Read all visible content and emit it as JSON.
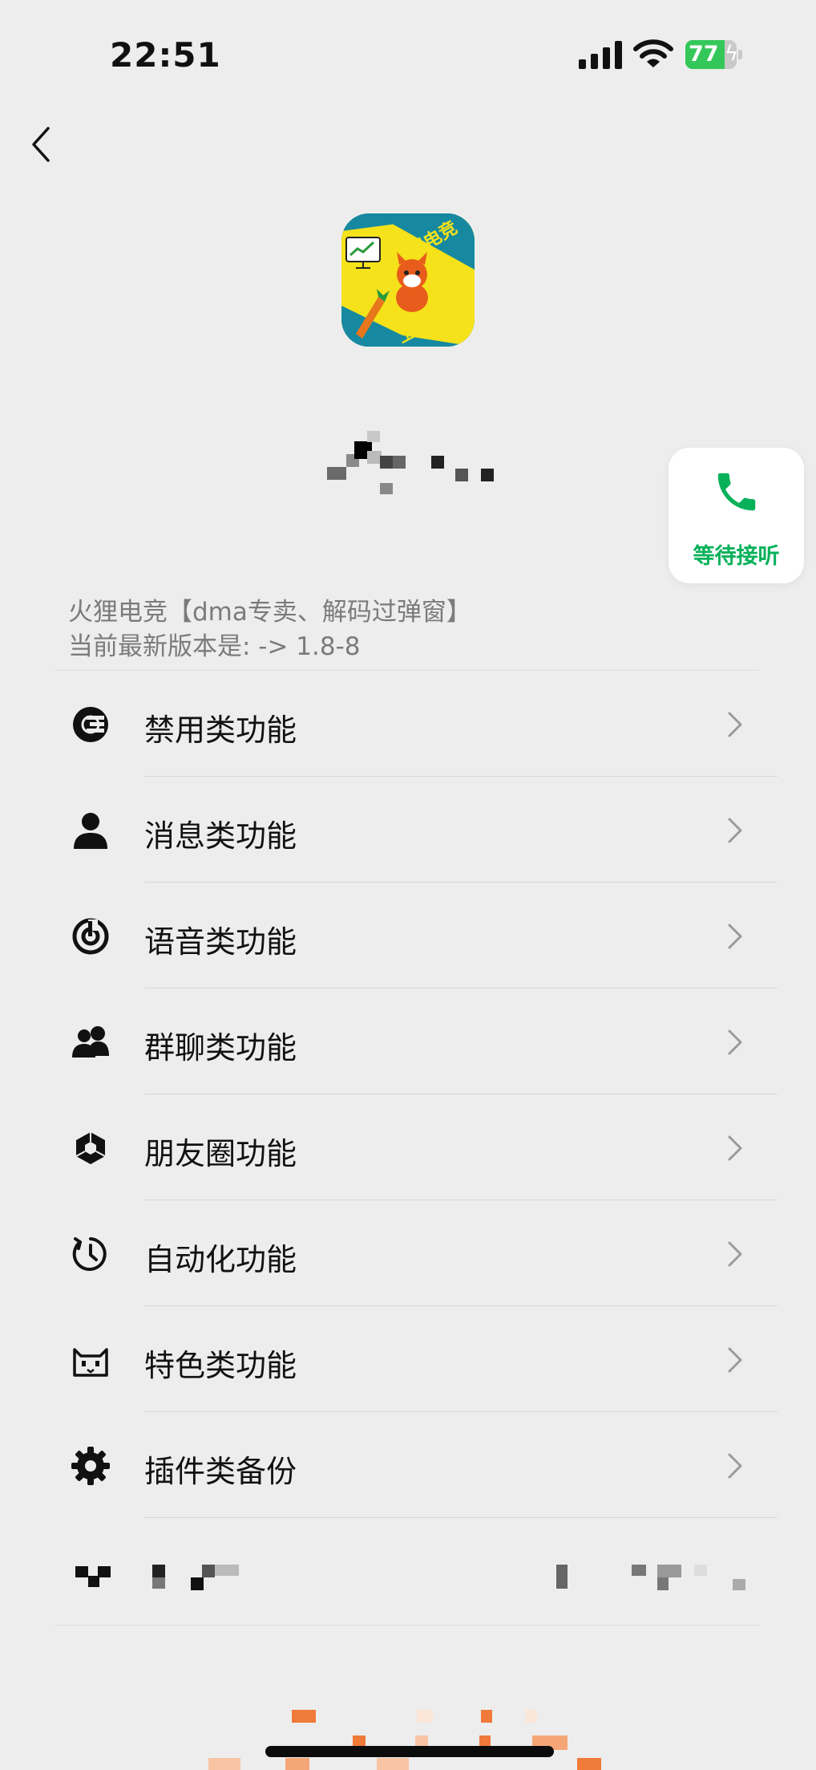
{
  "status_bar": {
    "time": "22:51",
    "battery_percent": "77",
    "battery_level": 0.77,
    "battery_charging": true,
    "signal_icon": "signal-bars-icon",
    "wifi_icon": "wifi-icon",
    "battery_color": "#34c759"
  },
  "nav": {
    "back_icon": "chevron-left-icon"
  },
  "app": {
    "logo_text_top": "火狸电竞",
    "logo_text_bottom": "工作室",
    "name_censored": true
  },
  "call_button": {
    "label": "等待接听",
    "icon": "phone-icon",
    "accent": "#07b15a"
  },
  "intro": {
    "line1": "火狸电竞【dma专卖、解码过弹窗】",
    "line2": "当前最新版本是: -> 1.8-8"
  },
  "menu": {
    "items": [
      {
        "label": "禁用类功能",
        "icon": "block-feature-icon"
      },
      {
        "label": "消息类功能",
        "icon": "user-icon"
      },
      {
        "label": "语音类功能",
        "icon": "voice-icon"
      },
      {
        "label": "群聊类功能",
        "icon": "group-icon"
      },
      {
        "label": "朋友圈功能",
        "icon": "moments-icon"
      },
      {
        "label": "自动化功能",
        "icon": "timer-icon"
      },
      {
        "label": "特色类功能",
        "icon": "cat-icon"
      },
      {
        "label": "插件类备份",
        "icon": "gear-icon"
      }
    ],
    "chevron_icon": "chevron-right-icon"
  },
  "censored_row": {
    "censored": true
  },
  "colors": {
    "background": "#ededed",
    "text_secondary": "#7b7b7b",
    "accent_green": "#07b15a"
  }
}
